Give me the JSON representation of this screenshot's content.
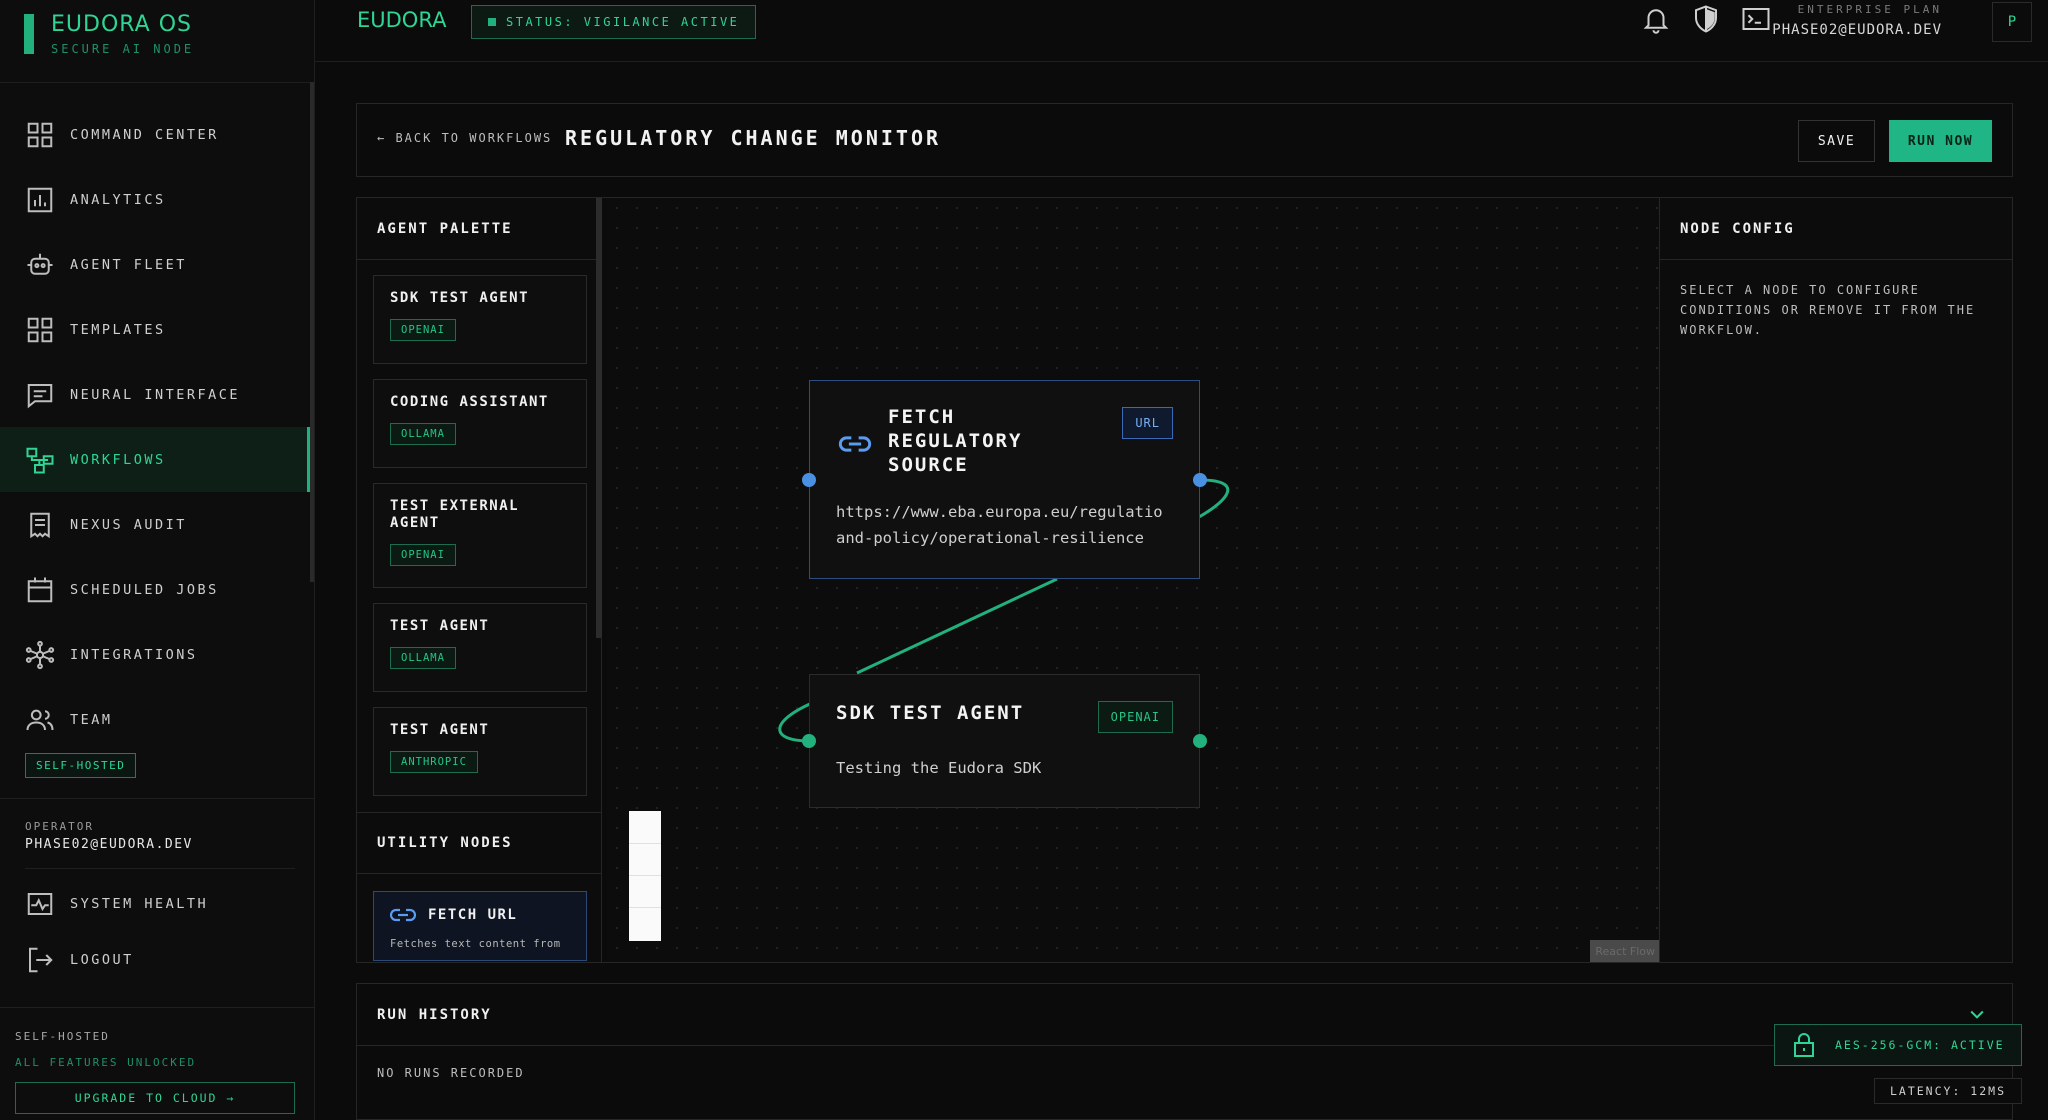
{
  "brand": {
    "name": "EUDORA OS",
    "subtitle": "SECURE AI NODE"
  },
  "sidebar": {
    "items": [
      {
        "label": "COMMAND CENTER",
        "icon": "grid-icon"
      },
      {
        "label": "ANALYTICS",
        "icon": "analytics-icon"
      },
      {
        "label": "AGENT FLEET",
        "icon": "robot-icon"
      },
      {
        "label": "TEMPLATES",
        "icon": "grid-icon"
      },
      {
        "label": "NEURAL INTERFACE",
        "icon": "chat-icon"
      },
      {
        "label": "WORKFLOWS",
        "icon": "workflow-icon",
        "active": true
      },
      {
        "label": "NEXUS AUDIT",
        "icon": "receipt-icon"
      },
      {
        "label": "SCHEDULED JOBS",
        "icon": "calendar-icon"
      },
      {
        "label": "INTEGRATIONS",
        "icon": "hub-icon"
      },
      {
        "label": "TEAM",
        "icon": "team-icon"
      }
    ],
    "badge": "SELF-HOSTED",
    "operator_label": "OPERATOR",
    "operator_email": "PHASE02@EUDORA.DEV",
    "system_health": "SYSTEM HEALTH",
    "logout": "LOGOUT",
    "footer_label": "SELF-HOSTED",
    "footer_sub": "ALL FEATURES UNLOCKED",
    "upgrade": "UPGRADE TO CLOUD →"
  },
  "topbar": {
    "logo": "EUDORA",
    "status": "STATUS: VIGILANCE ACTIVE",
    "plan_label": "ENTERPRISE PLAN",
    "email": "PHASE02@EUDORA.DEV",
    "avatar": "P"
  },
  "workflow": {
    "back": "← BACK TO WORKFLOWS",
    "title": "REGULATORY CHANGE MONITOR",
    "save": "SAVE",
    "run": "RUN NOW"
  },
  "palette": {
    "title": "AGENT PALETTE",
    "agents": [
      {
        "name": "SDK TEST AGENT",
        "provider": "OPENAI"
      },
      {
        "name": "CODING ASSISTANT",
        "provider": "OLLAMA"
      },
      {
        "name": "TEST EXTERNAL AGENT",
        "provider": "OPENAI"
      },
      {
        "name": "TEST AGENT",
        "provider": "OLLAMA"
      },
      {
        "name": "TEST AGENT",
        "provider": "ANTHROPIC"
      }
    ],
    "utility_title": "UTILITY NODES",
    "utility": {
      "name": "FETCH URL",
      "desc": "Fetches text content from"
    }
  },
  "canvas": {
    "fetch_node": {
      "title": "FETCH REGULATORY SOURCE",
      "tag": "URL",
      "line1": "https://www.eba.europa.eu/regulatio",
      "line2": "and-policy/operational-resilience"
    },
    "agent_node": {
      "title": "SDK TEST AGENT",
      "tag": "OPENAI",
      "desc": "Testing the Eudora SDK"
    },
    "attribution": "React Flow"
  },
  "config": {
    "title": "NODE CONFIG",
    "hint": "SELECT A NODE TO CONFIGURE CONDITIONS OR REMOVE IT FROM THE WORKFLOW."
  },
  "run_history": {
    "title": "RUN HISTORY",
    "empty": "NO RUNS RECORDED"
  },
  "security": {
    "aes": "AES-256-GCM: ACTIVE",
    "latency": "LATENCY: 12MS"
  },
  "colors": {
    "accent": "#22b07d",
    "accent_text": "#2fd594",
    "node_blue": "#4a90e2",
    "bg": "#0b0b0b"
  }
}
